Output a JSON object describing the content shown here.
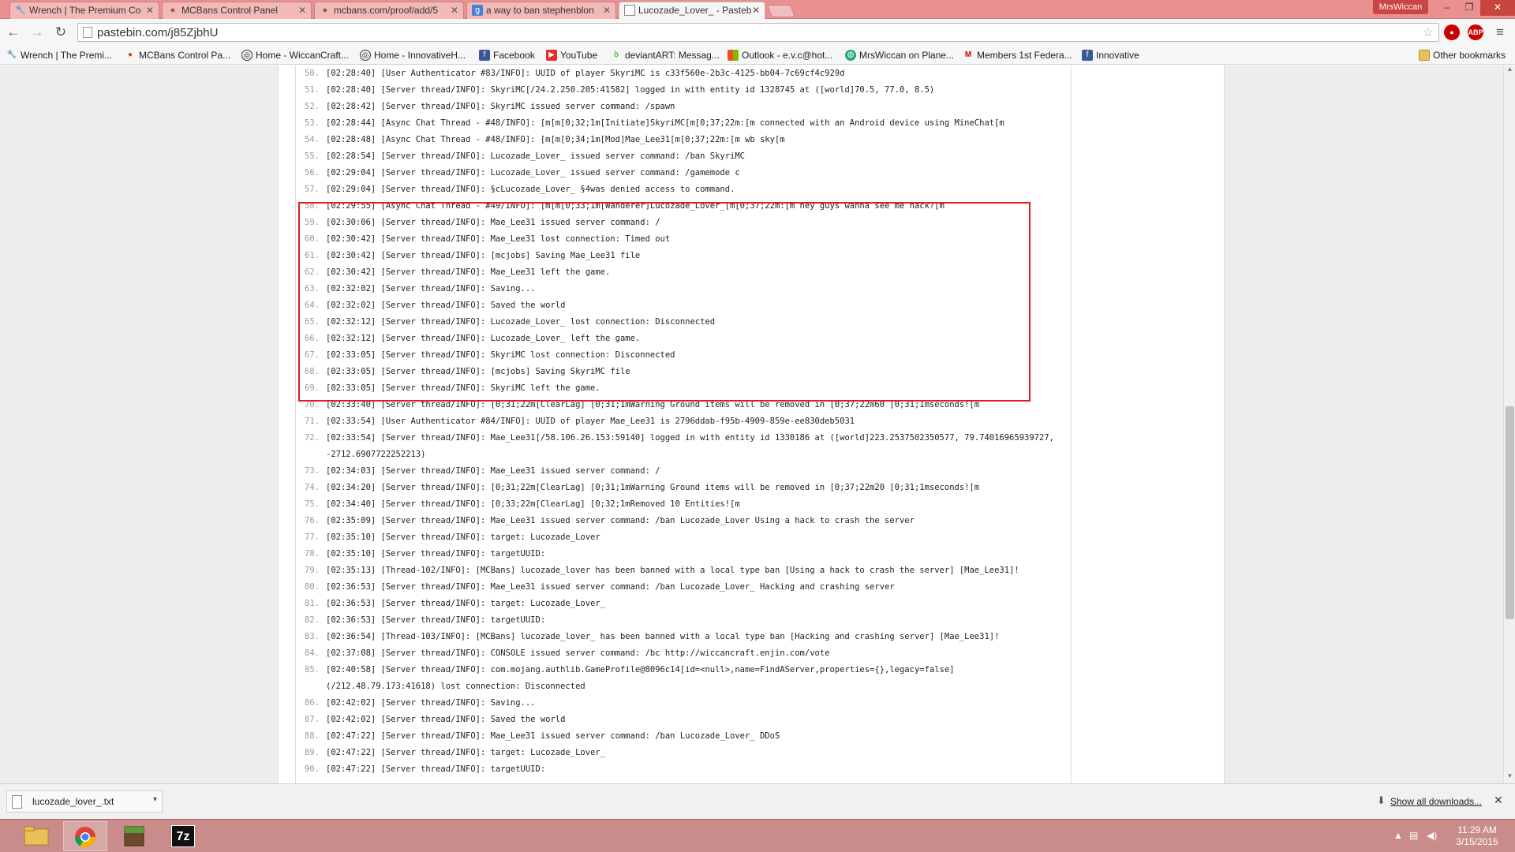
{
  "browser": {
    "tabs": [
      {
        "label": "Wrench | The Premium Co"
      },
      {
        "label": "MCBans Control Panel"
      },
      {
        "label": "mcbans.com/proof/add/5"
      },
      {
        "label": "a way to ban stephenblon"
      },
      {
        "label": "Lucozade_Lover_ - Pasteb"
      }
    ],
    "user_badge": "MrsWiccan",
    "url": "pastebin.com/j85ZjbhU",
    "extension_abp": "ABP",
    "bookmarks": [
      {
        "label": "Wrench | The Premi..."
      },
      {
        "label": "MCBans Control Pa..."
      },
      {
        "label": "Home - WiccanCraft..."
      },
      {
        "label": "Home - InnovativeH..."
      },
      {
        "label": "Facebook"
      },
      {
        "label": "YouTube"
      },
      {
        "label": "deviantART: Messag..."
      },
      {
        "label": "Outlook - e.v.c@hot..."
      },
      {
        "label": "MrsWiccan on Plane..."
      },
      {
        "label": "Members 1st Federa..."
      },
      {
        "label": "Innovative"
      }
    ],
    "other_bookmarks": "Other bookmarks"
  },
  "log": {
    "lines": [
      {
        "n": "50.",
        "text": "[02:28:40] [User Authenticator #83/INFO]: UUID of player SkyriMC is c33f560e-2b3c-4125-bb04-7c69cf4c929d"
      },
      {
        "n": "51.",
        "text": "[02:28:40] [Server thread/INFO]: SkyriMC[/24.2.250.205:41582] logged in with entity id 1328745 at ([world]70.5, 77.0, 8.5)"
      },
      {
        "n": "52.",
        "text": "[02:28:42] [Server thread/INFO]: SkyriMC issued server command: /spawn"
      },
      {
        "n": "53.",
        "text": "[02:28:44] [Async Chat Thread - #48/INFO]: [m[m[0;32;1m[Initiate]SkyriMC[m[0;37;22m:[m connected with an Android device using MineChat[m"
      },
      {
        "n": "54.",
        "text": "[02:28:48] [Async Chat Thread - #48/INFO]: [m[m[0;34;1m[Mod]Mae_Lee31[m[0;37;22m:[m wb sky[m"
      },
      {
        "n": "55.",
        "text": "[02:28:54] [Server thread/INFO]: Lucozade_Lover_ issued server command: /ban SkyriMC"
      },
      {
        "n": "56.",
        "text": "[02:29:04] [Server thread/INFO]: Lucozade_Lover_ issued server command: /gamemode c"
      },
      {
        "n": "57.",
        "text": "[02:29:04] [Server thread/INFO]: §cLucozade_Lover_ §4was denied access to command."
      },
      {
        "n": "58.",
        "text": "[02:29:55] [Async Chat Thread - #49/INFO]: [m[m[0;33;1m[Wanderer]Lucozade_Lover_[m[0;37;22m:[m hey guys wanna see me hack?[m"
      },
      {
        "n": "59.",
        "text": "[02:30:06] [Server thread/INFO]: Mae_Lee31 issued server command: /"
      },
      {
        "n": "60.",
        "text": "[02:30:42] [Server thread/INFO]: Mae_Lee31 lost connection: Timed out"
      },
      {
        "n": "61.",
        "text": "[02:30:42] [Server thread/INFO]: [mcjobs] Saving Mae_Lee31 file"
      },
      {
        "n": "62.",
        "text": "[02:30:42] [Server thread/INFO]: Mae_Lee31 left the game."
      },
      {
        "n": "63.",
        "text": "[02:32:02] [Server thread/INFO]: Saving..."
      },
      {
        "n": "64.",
        "text": "[02:32:02] [Server thread/INFO]: Saved the world"
      },
      {
        "n": "65.",
        "text": "[02:32:12] [Server thread/INFO]: Lucozade_Lover_ lost connection: Disconnected"
      },
      {
        "n": "66.",
        "text": "[02:32:12] [Server thread/INFO]: Lucozade_Lover_ left the game."
      },
      {
        "n": "67.",
        "text": "[02:33:05] [Server thread/INFO]: SkyriMC lost connection: Disconnected"
      },
      {
        "n": "68.",
        "text": "[02:33:05] [Server thread/INFO]: [mcjobs] Saving SkyriMC file"
      },
      {
        "n": "69.",
        "text": "[02:33:05] [Server thread/INFO]: SkyriMC left the game."
      },
      {
        "n": "70.",
        "text": "[02:33:40] [Server thread/INFO]: [0;31;22m[ClearLag] [0;31;1mWarning Ground items will be removed in [0;37;22m60 [0;31;1mseconds![m"
      },
      {
        "n": "71.",
        "text": "[02:33:54] [User Authenticator #84/INFO]: UUID of player Mae_Lee31 is 2796ddab-f95b-4909-859e-ee830deb5031"
      },
      {
        "n": "72.",
        "text": "[02:33:54] [Server thread/INFO]: Mae_Lee31[/58.106.26.153:59140] logged in with entity id 1330186 at ([world]223.2537502350577, 79.74016965939727, -2712.6907722252213)",
        "wrap": true
      },
      {
        "n": "73.",
        "text": "[02:34:03] [Server thread/INFO]: Mae_Lee31 issued server command: /"
      },
      {
        "n": "74.",
        "text": "[02:34:20] [Server thread/INFO]: [0;31;22m[ClearLag] [0;31;1mWarning Ground items will be removed in [0;37;22m20 [0;31;1mseconds![m"
      },
      {
        "n": "75.",
        "text": "[02:34:40] [Server thread/INFO]: [0;33;22m[ClearLag] [0;32;1mRemoved 10 Entities![m"
      },
      {
        "n": "76.",
        "text": "[02:35:09] [Server thread/INFO]: Mae_Lee31 issued server command: /ban Lucozade_Lover Using a hack to crash the server"
      },
      {
        "n": "77.",
        "text": "[02:35:10] [Server thread/INFO]: target: Lucozade_Lover"
      },
      {
        "n": "78.",
        "text": "[02:35:10] [Server thread/INFO]: targetUUID:"
      },
      {
        "n": "79.",
        "text": "[02:35:13] [Thread-102/INFO]: [MCBans] lucozade_lover has been banned with a local type ban [Using a hack to crash the server] [Mae_Lee31]!"
      },
      {
        "n": "80.",
        "text": "[02:36:53] [Server thread/INFO]: Mae_Lee31 issued server command: /ban Lucozade_Lover_ Hacking and crashing server"
      },
      {
        "n": "81.",
        "text": "[02:36:53] [Server thread/INFO]: target: Lucozade_Lover_"
      },
      {
        "n": "82.",
        "text": "[02:36:53] [Server thread/INFO]: targetUUID:"
      },
      {
        "n": "83.",
        "text": "[02:36:54] [Thread-103/INFO]: [MCBans] lucozade_lover_ has been banned with a local type ban [Hacking and crashing server] [Mae_Lee31]!"
      },
      {
        "n": "84.",
        "text": "[02:37:08] [Server thread/INFO]: CONSOLE issued server command: /bc http://wiccancraft.enjin.com/vote"
      },
      {
        "n": "85.",
        "text": "[02:40:58] [Server thread/INFO]: com.mojang.authlib.GameProfile@8096c14[id=<null>,name=FindAServer,properties={},legacy=false] (/212.48.79.173:41618) lost connection: Disconnected",
        "wrap": true
      },
      {
        "n": "86.",
        "text": "[02:42:02] [Server thread/INFO]: Saving..."
      },
      {
        "n": "87.",
        "text": "[02:42:02] [Server thread/INFO]: Saved the world"
      },
      {
        "n": "88.",
        "text": "[02:47:22] [Server thread/INFO]: Mae_Lee31 issued server command: /ban Lucozade_Lover_ DDoS"
      },
      {
        "n": "89.",
        "text": "[02:47:22] [Server thread/INFO]: target: Lucozade_Lover_"
      },
      {
        "n": "90.",
        "text": "[02:47:22] [Server thread/INFO]: targetUUID:"
      }
    ]
  },
  "downloads": {
    "file": "lucozade_lover_.txt",
    "show_all": "Show all downloads..."
  },
  "taskbar": {
    "apps": [
      "file-explorer",
      "chrome",
      "minecraft",
      "7-zip"
    ],
    "sevenzip_label": "7z",
    "time": "11:29 AM",
    "date": "3/15/2015"
  }
}
